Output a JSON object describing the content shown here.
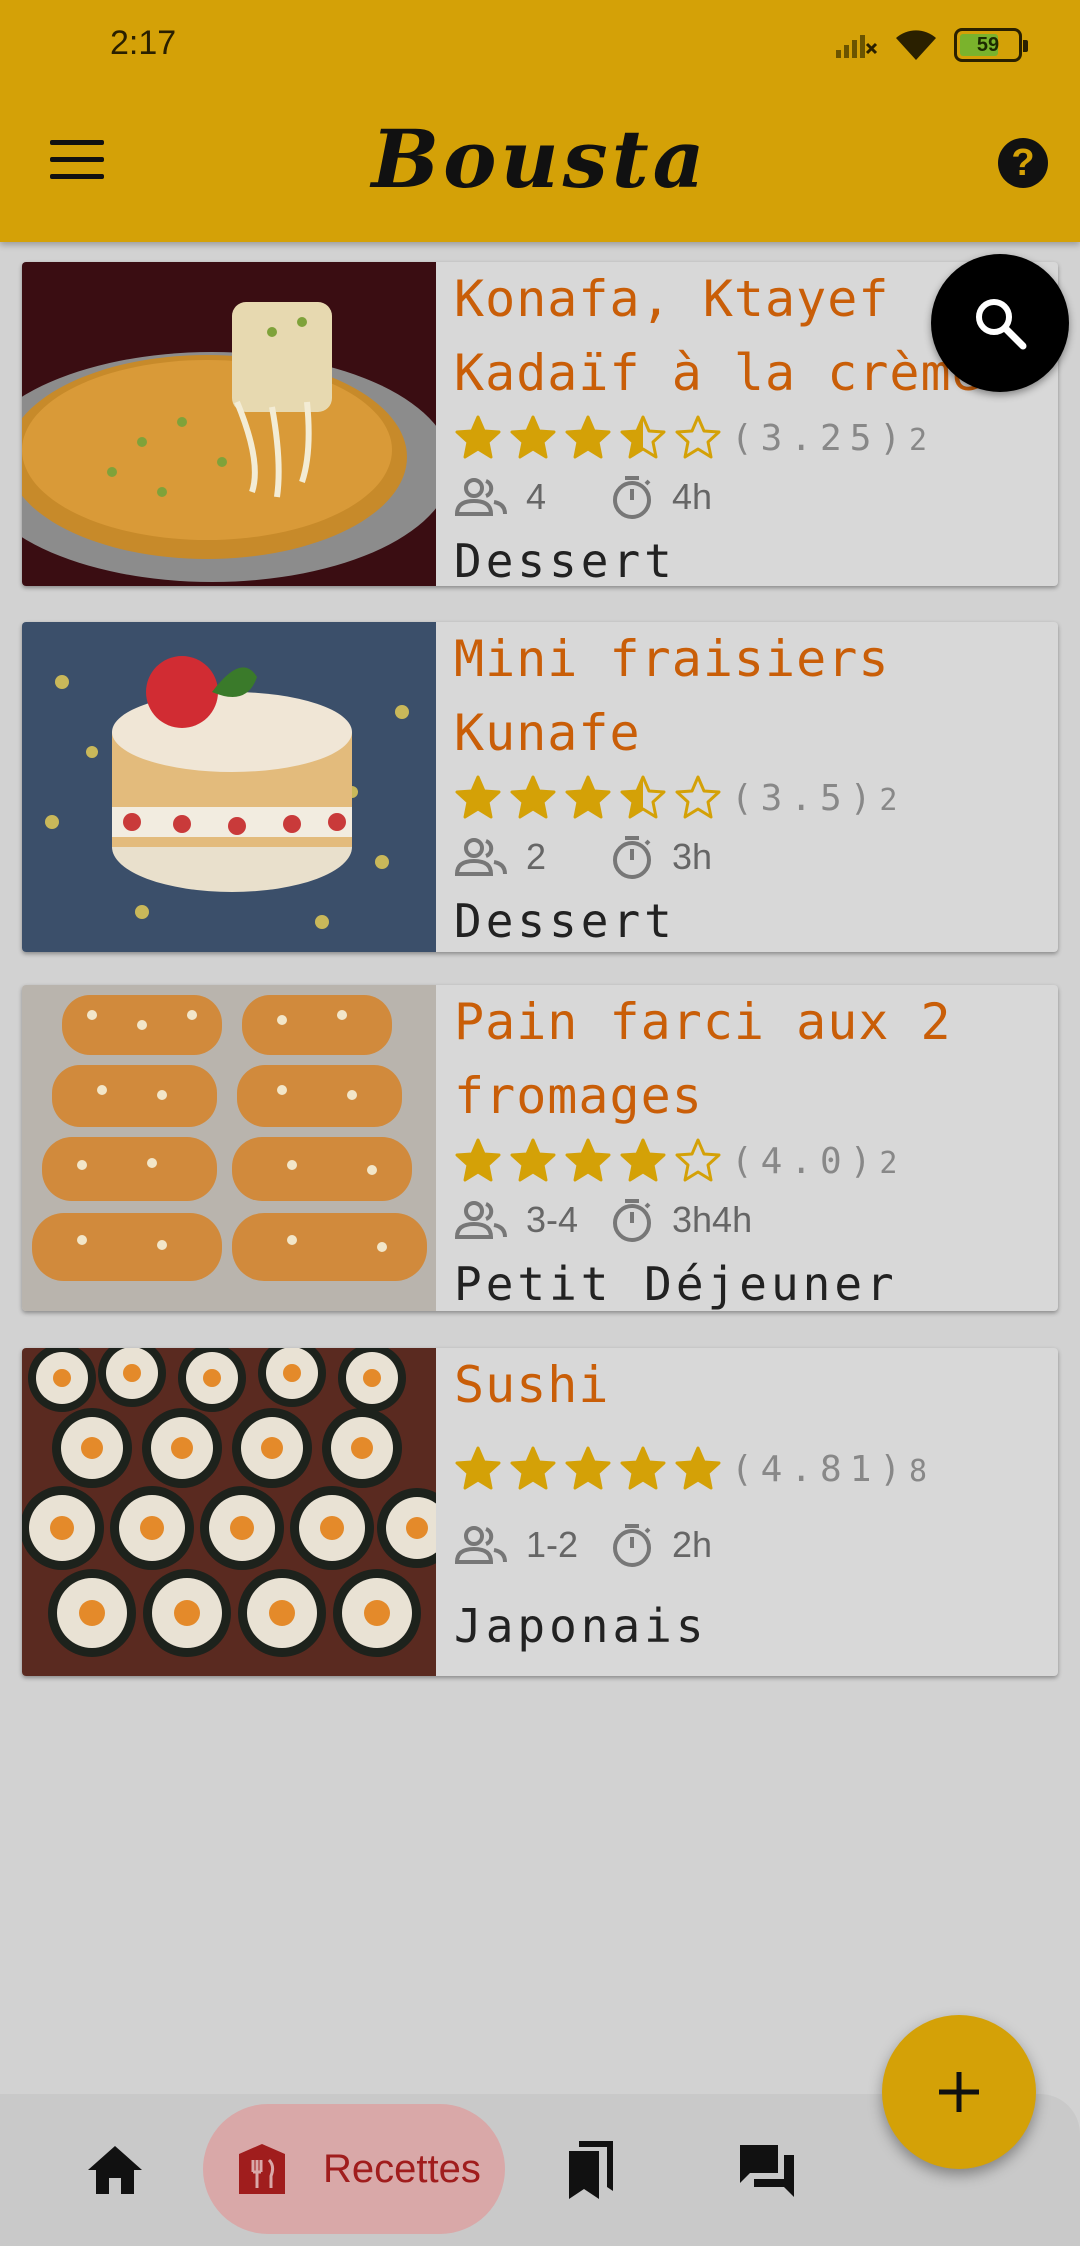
{
  "status_bar": {
    "time": "2:17",
    "battery": "59"
  },
  "app_bar": {
    "title": "Bousta"
  },
  "recipes": [
    {
      "title_line1": "Konafa, Ktayef",
      "title_line2": "Kadaïf à la crème",
      "rating": "(3.25)",
      "rating_count": "2",
      "stars": 3.25,
      "servings": "4",
      "time": "4h",
      "category": "Dessert"
    },
    {
      "title_line1": "Mini fraisiers",
      "title_line2": "Kunafe",
      "rating": "(3.5)",
      "rating_count": "2",
      "stars": 3.5,
      "servings": "2",
      "time": "3h",
      "category": "Dessert"
    },
    {
      "title_line1": "Pain farci aux 2",
      "title_line2": "fromages",
      "rating": "(4.0)",
      "rating_count": "2",
      "stars": 4.0,
      "servings": "3-4",
      "time": "3h4h",
      "category": "Petit Déjeuner"
    },
    {
      "title_line1": "Sushi",
      "title_line2": "",
      "rating": "(4.81)",
      "rating_count": "8",
      "stars": 4.81,
      "servings": "1-2",
      "time": "2h",
      "category": "Japonais"
    }
  ],
  "bottom_nav": {
    "active_label": "Recettes"
  },
  "icons": {
    "menu": "menu-icon",
    "help": "help-icon",
    "search": "search-icon",
    "servings": "people-icon",
    "time": "timer-icon",
    "home": "home-icon",
    "recipes": "restaurant-icon",
    "bookmarks": "bookmarks-icon",
    "chat": "forum-icon",
    "add": "plus-icon"
  },
  "colors": {
    "accent": "#d4a107",
    "title": "#c95e08",
    "star": "#d4a107",
    "nav_active_bg": "#d9a8a8",
    "nav_active_text": "#a01d1d"
  }
}
